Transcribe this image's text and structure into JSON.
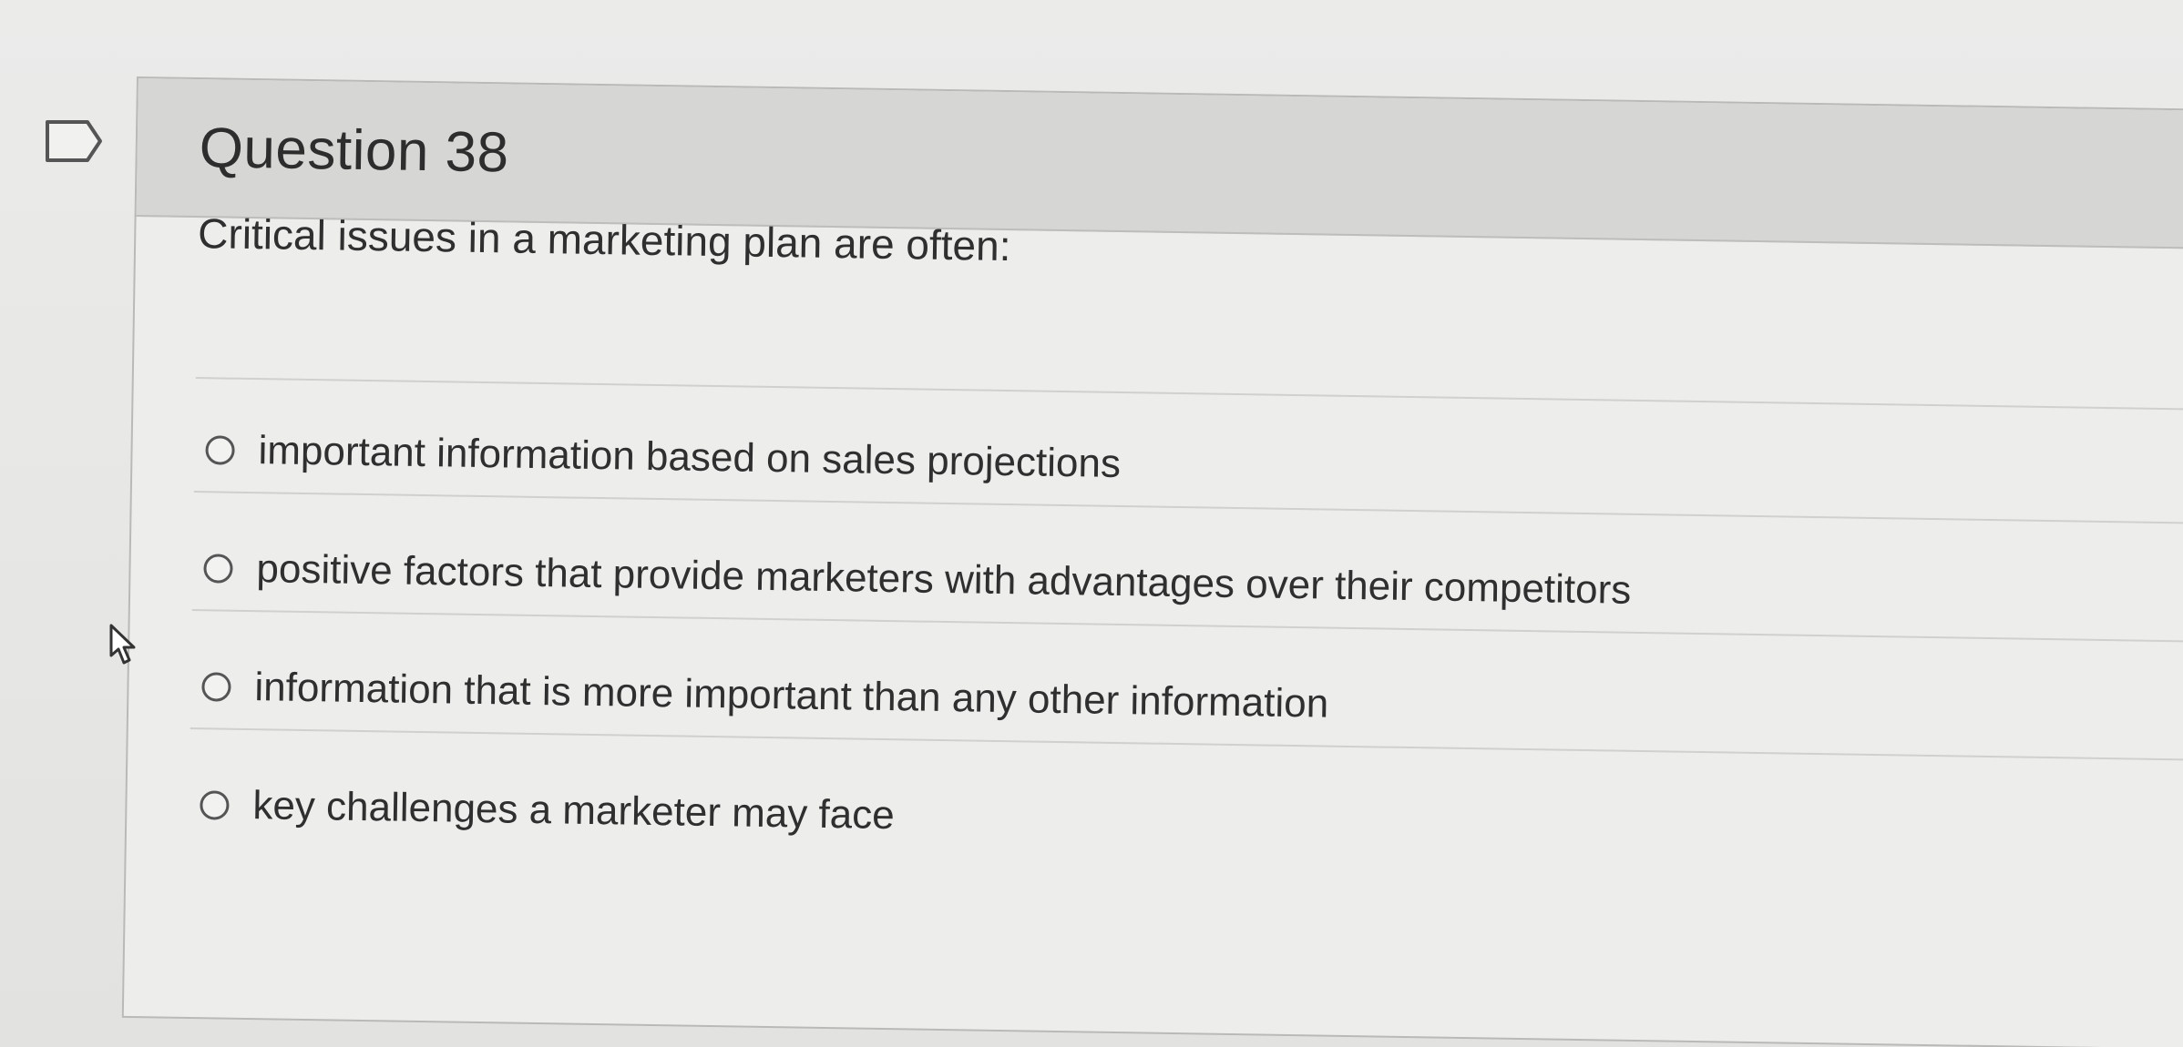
{
  "question": {
    "title": "Question 38",
    "prompt": "Critical issues in a marketing plan are often:",
    "options": [
      {
        "label": "important information based on sales projections",
        "selected": false
      },
      {
        "label": "positive factors that provide marketers with advantages over their competitors",
        "selected": false
      },
      {
        "label": "information that is more important than any other information",
        "selected": false
      },
      {
        "label": "key challenges a marketer may face",
        "selected": false
      }
    ]
  },
  "icons": {
    "flag": "flag-outline-icon",
    "cursor": "mouse-pointer-icon"
  }
}
